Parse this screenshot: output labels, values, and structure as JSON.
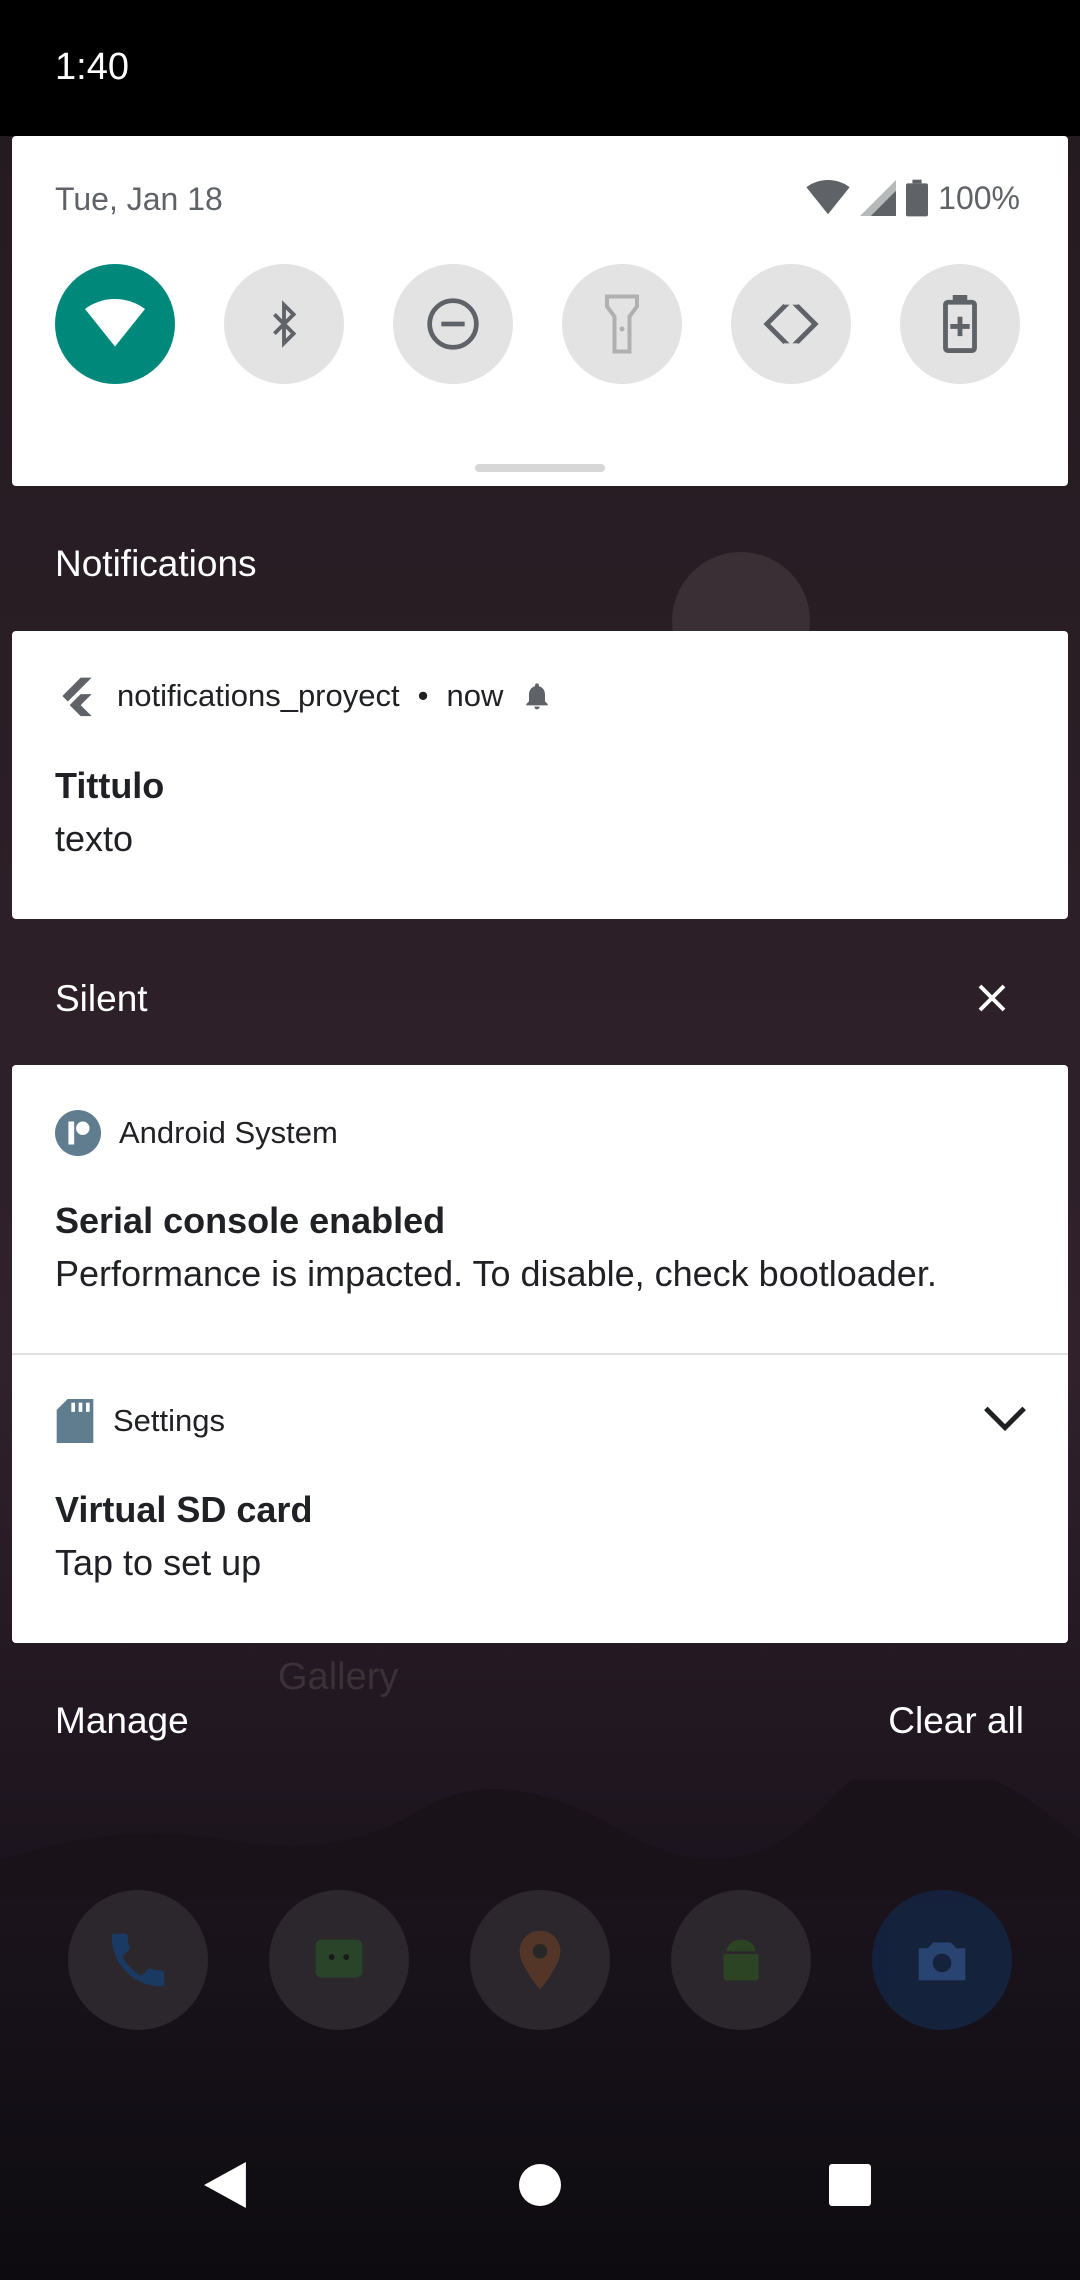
{
  "status_bar": {
    "time": "1:40"
  },
  "quick_settings": {
    "date": "Tue, Jan 18",
    "battery": "100%",
    "tiles": [
      {
        "name": "wifi",
        "active": true
      },
      {
        "name": "bluetooth",
        "active": false
      },
      {
        "name": "do-not-disturb",
        "active": false
      },
      {
        "name": "flashlight",
        "active": false
      },
      {
        "name": "auto-rotate",
        "active": false
      },
      {
        "name": "battery-saver",
        "active": false
      }
    ],
    "accent_color": "#00897b"
  },
  "notifications_section": {
    "title": "Notifications",
    "items": [
      {
        "app": "notifications_proyect",
        "separator": "•",
        "time": "now",
        "title": "Tittulo",
        "text": "texto"
      }
    ]
  },
  "silent_section": {
    "title": "Silent",
    "items": [
      {
        "app": "Android System",
        "title": "Serial console enabled",
        "text": "Performance is impacted. To disable, check bootloader."
      },
      {
        "app": "Settings",
        "title": "Virtual SD card",
        "text": "Tap to set up"
      }
    ]
  },
  "actions": {
    "manage": "Manage",
    "clear_all": "Clear all"
  },
  "home_screen": {
    "gallery_label": "Gallery"
  }
}
